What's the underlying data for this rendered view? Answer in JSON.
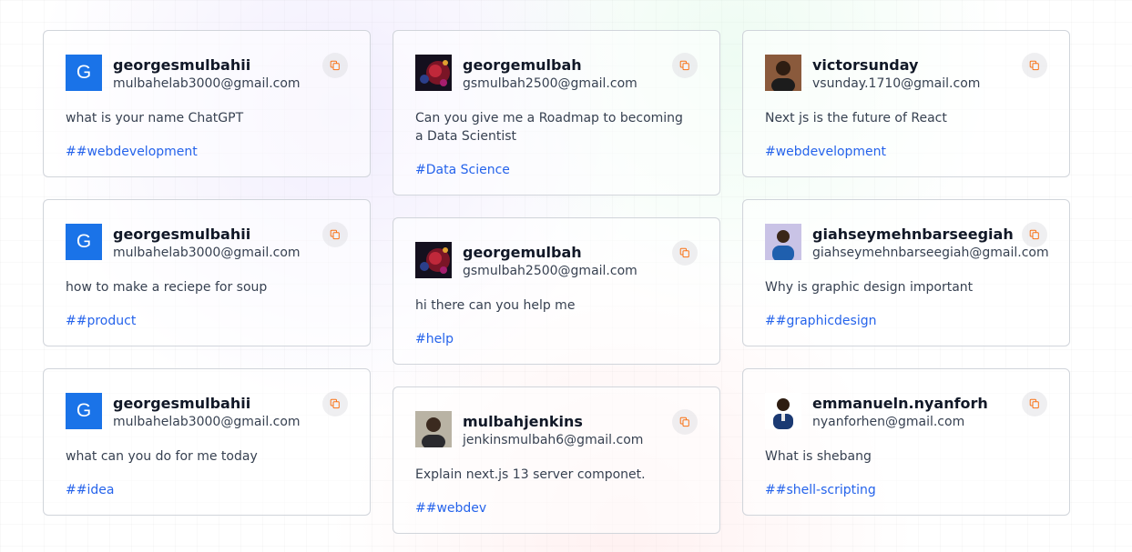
{
  "colors": {
    "tag_blue": "#2563eb",
    "avatar_blue": "#1a73e8",
    "copy_icon_orange": "#f97316"
  },
  "icons": {
    "copy": "copy-icon"
  },
  "columns": [
    [
      {
        "username": "georgesmulbahii",
        "email": "mulbahelab3000@gmail.com",
        "avatar": "letter",
        "avatar_letter": "G",
        "prompt": "what is your name ChatGPT",
        "tag": "##webdevelopment"
      },
      {
        "username": "georgesmulbahii",
        "email": "mulbahelab3000@gmail.com",
        "avatar": "letter",
        "avatar_letter": "G",
        "prompt": "how to make a reciepe for soup",
        "tag": "##product"
      },
      {
        "username": "georgesmulbahii",
        "email": "mulbahelab3000@gmail.com",
        "avatar": "letter",
        "avatar_letter": "G",
        "prompt": "what can you do for me today",
        "tag": "##idea"
      }
    ],
    [
      {
        "username": "georgemulbah",
        "email": "gsmulbah2500@gmail.com",
        "avatar": "art",
        "prompt": "Can you give me a Roadmap to becoming a Data Scientist",
        "tag": "#Data Science"
      },
      {
        "username": "georgemulbah",
        "email": "gsmulbah2500@gmail.com",
        "avatar": "art",
        "prompt": "hi there can you help me",
        "tag": "#help"
      },
      {
        "username": "mulbahjenkins",
        "email": "jenkinsmulbah6@gmail.com",
        "avatar": "photo-tan",
        "prompt": "Explain next.js 13 server componet.",
        "tag": "##webdev"
      }
    ],
    [
      {
        "username": "victorsunday",
        "email": "vsunday.1710@gmail.com",
        "avatar": "photo-brown",
        "prompt": "Next js is the future of React",
        "tag": "#webdevelopment"
      },
      {
        "username": "giahseymehnbarseegiah",
        "email": "giahseymehnbarseegiah@gmail.com",
        "avatar": "photo-lavender",
        "prompt": "Why is graphic design important",
        "tag": "##graphicdesign"
      },
      {
        "username": "emmanueln.nyanforh",
        "email": "nyanforhen@gmail.com",
        "avatar": "photo-white",
        "prompt": "What is shebang",
        "tag": "##shell-scripting"
      }
    ]
  ]
}
